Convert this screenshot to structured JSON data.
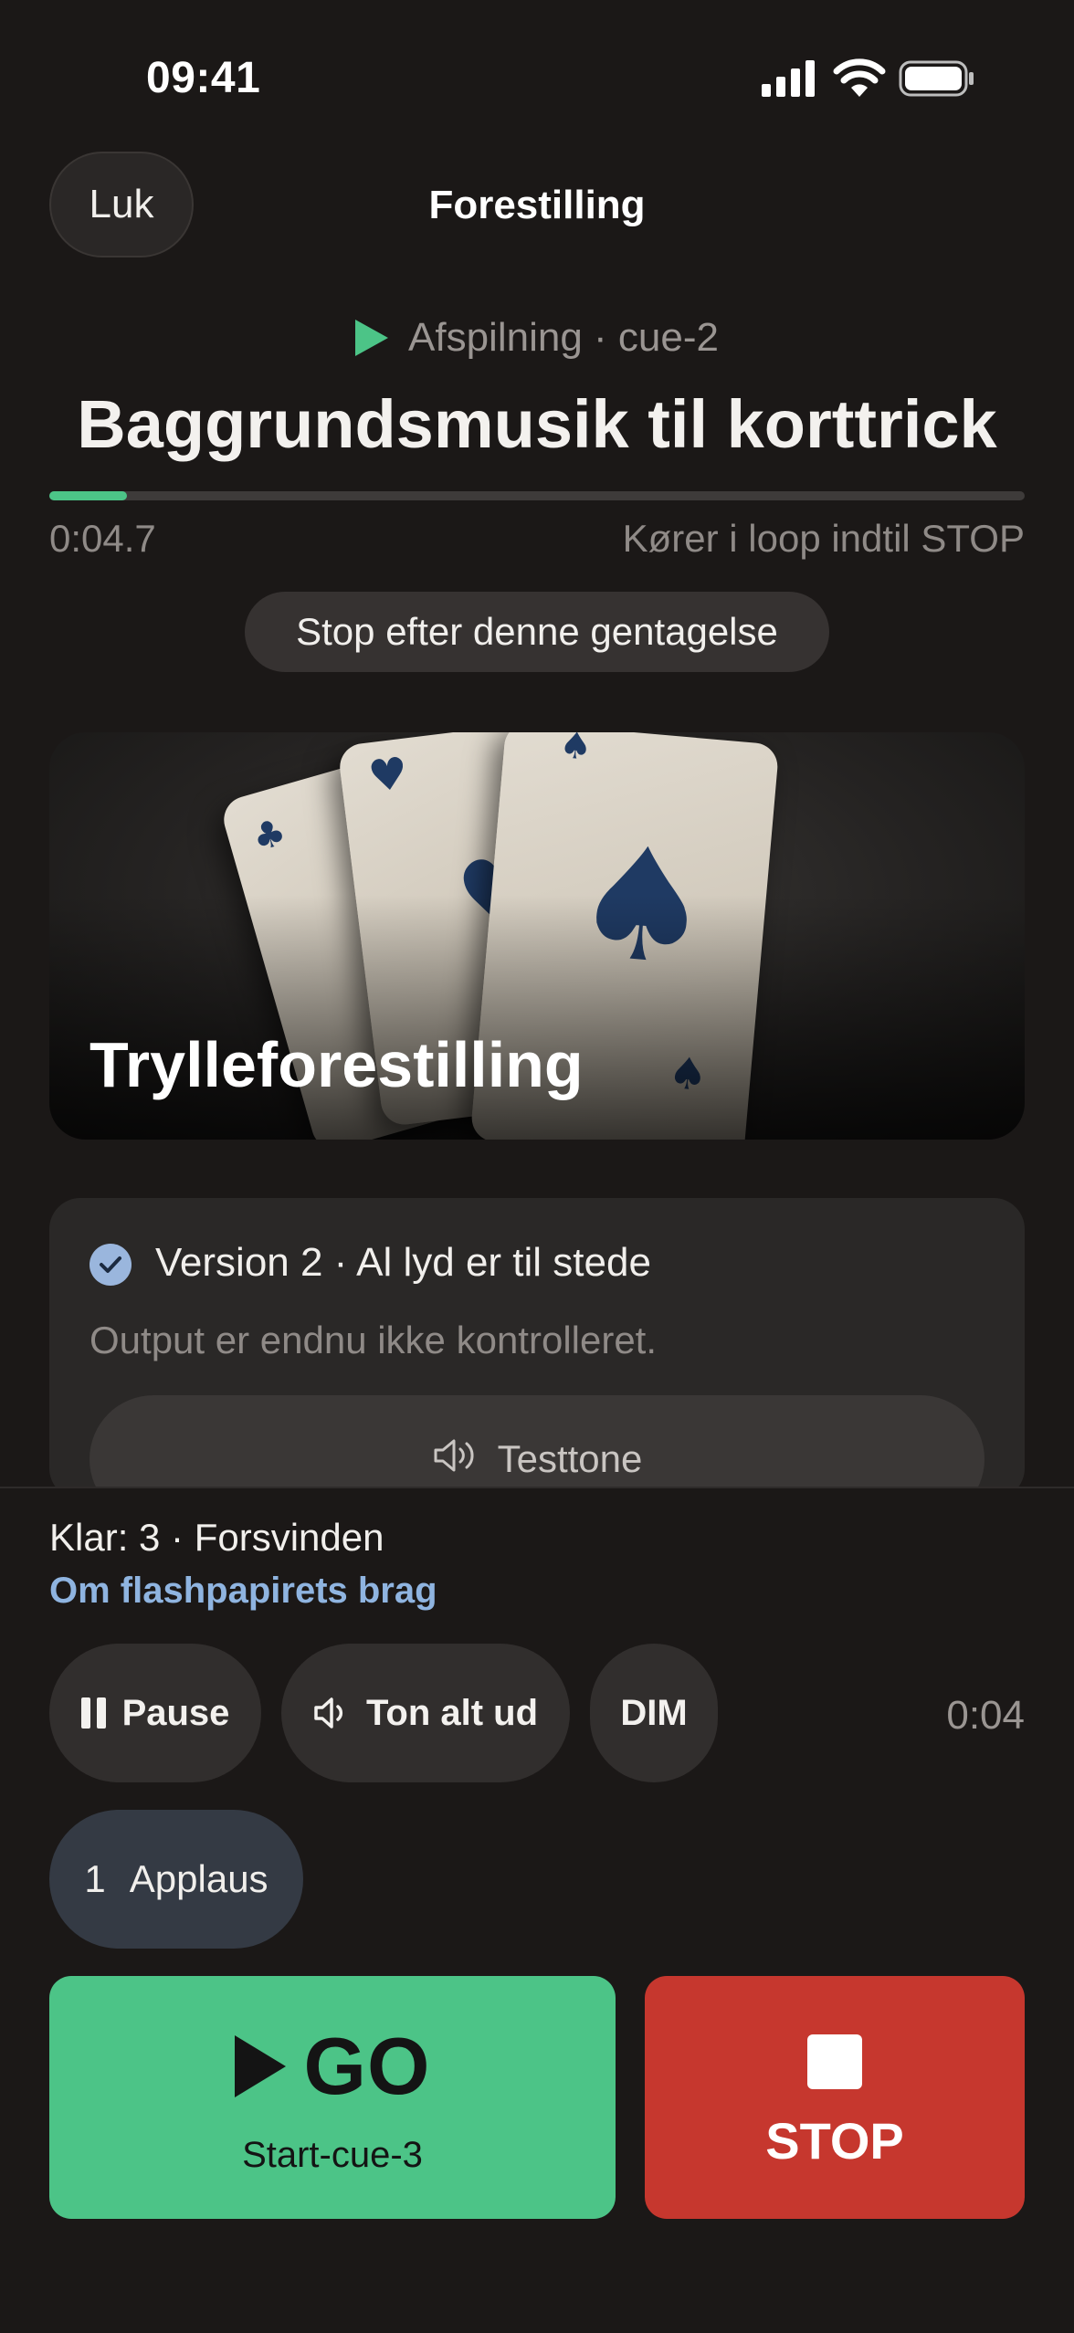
{
  "status_bar": {
    "time": "09:41"
  },
  "header": {
    "close_label": "Luk",
    "title": "Forestilling"
  },
  "now_playing": {
    "status": "Afspilning · cue-2",
    "title": "Baggrundsmusik til korttrick",
    "progress_fraction": 0.08,
    "elapsed": "0:04.7",
    "loop_note": "Kører i loop indtil STOP",
    "stop_after_label": "Stop efter denne gentagelse"
  },
  "show": {
    "title": "Trylleforestilling"
  },
  "version": {
    "text": "Version 2 · Al lyd er til stede",
    "note": "Output er endnu ikke kontrolleret.",
    "testtone_label": "Testtone"
  },
  "ready": {
    "line": "Klar: 3 · Forsvinden",
    "sub": "Om flashpapirets brag"
  },
  "controls": {
    "pause_label": "Pause",
    "tone_label": "Ton alt ud",
    "dim_label": "DIM",
    "timer": "0:04",
    "applaus_number": "1",
    "applaus_label": "Applaus"
  },
  "go": {
    "label": "GO",
    "sub": "Start-cue-3"
  },
  "stop": {
    "label": "STOP"
  },
  "colors": {
    "accent_green": "#4cc487",
    "stop_red": "#c6372e",
    "link_blue": "#8fb4e0"
  }
}
